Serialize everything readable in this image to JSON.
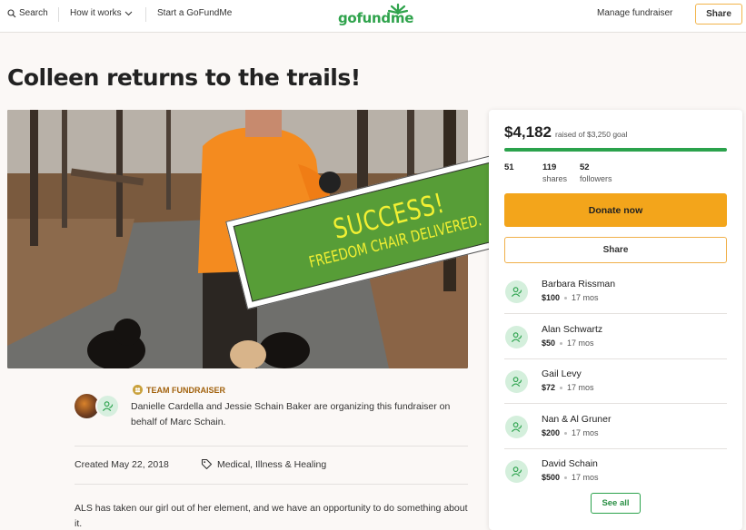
{
  "header": {
    "search_label": "Search",
    "how_it_works_label": "How it works",
    "start_label": "Start a GoFundMe",
    "logo_text": "gofundme",
    "manage_label": "Manage fundraiser",
    "share_label": "Share"
  },
  "campaign": {
    "title": "Colleen returns to the trails!",
    "team_label": "TEAM FUNDRAISER",
    "organizer_text": "Danielle Cardella and Jessie Schain Baker are organizing this fundraiser on behalf of Marc Schain.",
    "created": "Created May 22, 2018",
    "category": "Medical, Illness & Healing",
    "story": "ALS has taken our girl out of her element, and we have an opportunity to do something about it."
  },
  "banner": {
    "main": "SUCCESS!",
    "sub": "FREEDOM CHAIR DELIVERED."
  },
  "sidebar": {
    "raised_amount": "$4,182",
    "raised_goal": "raised of $3,250 goal",
    "progress_fraction": 1.0,
    "stats": [
      {
        "value": "51",
        "label": ""
      },
      {
        "value": "119",
        "label": "shares"
      },
      {
        "value": "52",
        "label": "followers"
      }
    ],
    "donate_label": "Donate now",
    "share_label": "Share",
    "donations": [
      {
        "name": "Barbara Rissman",
        "amount": "$100",
        "time": "17 mos"
      },
      {
        "name": "Alan Schwartz",
        "amount": "$50",
        "time": "17 mos"
      },
      {
        "name": "Gail Levy",
        "amount": "$72",
        "time": "17 mos"
      },
      {
        "name": "Nan & Al Gruner",
        "amount": "$200",
        "time": "17 mos"
      },
      {
        "name": "David Schain",
        "amount": "$500",
        "time": "17 mos"
      }
    ],
    "see_all_label": "See all"
  },
  "colors": {
    "brand_green": "#2ba24c",
    "donate_orange": "#f3a51b",
    "banner_green": "#579d37",
    "banner_text": "#f2f033"
  }
}
